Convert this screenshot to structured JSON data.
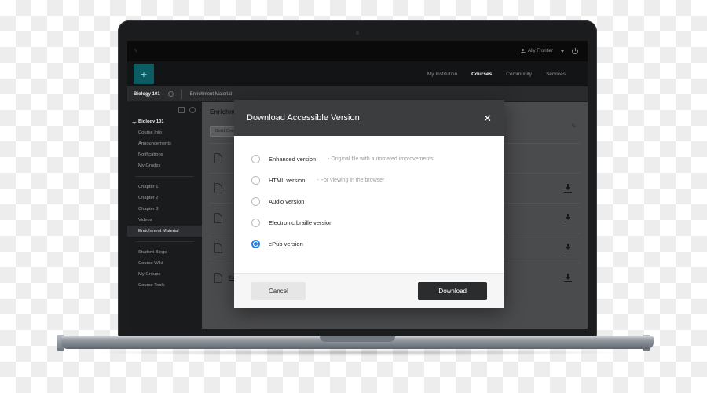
{
  "app": {
    "topbar": {
      "user_name": "Ally Frontier",
      "person_icon": "person-icon",
      "caret_icon": "chevron-down-icon",
      "power_icon": "power-icon"
    },
    "brand_logo": "+",
    "nav": [
      {
        "label": "My Institution",
        "active": false
      },
      {
        "label": "Courses",
        "active": true
      },
      {
        "label": "Community",
        "active": false
      },
      {
        "label": "Services",
        "active": false
      }
    ],
    "breadcrumb": {
      "course": "Biology 101",
      "section": "Enrichment Material"
    },
    "sidebar": {
      "items": [
        {
          "label": "Biology 101",
          "type": "root"
        },
        {
          "label": "Course Info",
          "type": "item"
        },
        {
          "label": "Announcements",
          "type": "item"
        },
        {
          "label": "Notifications",
          "type": "item"
        },
        {
          "label": "My Grades",
          "type": "item"
        },
        {
          "label": "Chapter 1",
          "type": "item"
        },
        {
          "label": "Chapter 2",
          "type": "item"
        },
        {
          "label": "Chapter 3",
          "type": "item"
        },
        {
          "label": "Videos",
          "type": "item"
        },
        {
          "label": "Enrichment Material",
          "type": "selected"
        },
        {
          "label": "Student Blogs",
          "type": "item"
        },
        {
          "label": "Course Wiki",
          "type": "item"
        },
        {
          "label": "My Groups",
          "type": "item"
        },
        {
          "label": "Course Tools",
          "type": "item"
        }
      ]
    },
    "content": {
      "title": "Enrichment Material",
      "build_label": "Build Content",
      "edit_icon": "pencil-icon",
      "rows": [
        {
          "label": "",
          "has_download": false
        },
        {
          "label": "",
          "has_download": true
        },
        {
          "label": "",
          "has_download": true
        },
        {
          "label": "",
          "has_download": true
        },
        {
          "label": "Kingdoms of Organisms",
          "has_download": true
        }
      ]
    }
  },
  "modal": {
    "title": "Download Accessible Version",
    "close_icon": "close-icon",
    "options": [
      {
        "main": "Enhanced version",
        "sub": "- Original file with automated improvements",
        "selected": false
      },
      {
        "main": "HTML version",
        "sub": "- For viewing in the browser",
        "selected": false
      },
      {
        "main": "Audio version",
        "sub": "",
        "selected": false
      },
      {
        "main": "Electronic braille version",
        "sub": "",
        "selected": false
      },
      {
        "main": "ePub version",
        "sub": "",
        "selected": true
      }
    ],
    "cancel_label": "Cancel",
    "download_label": "Download",
    "accent_color": "#2f7fe0",
    "header_color": "#3c3d3f"
  }
}
